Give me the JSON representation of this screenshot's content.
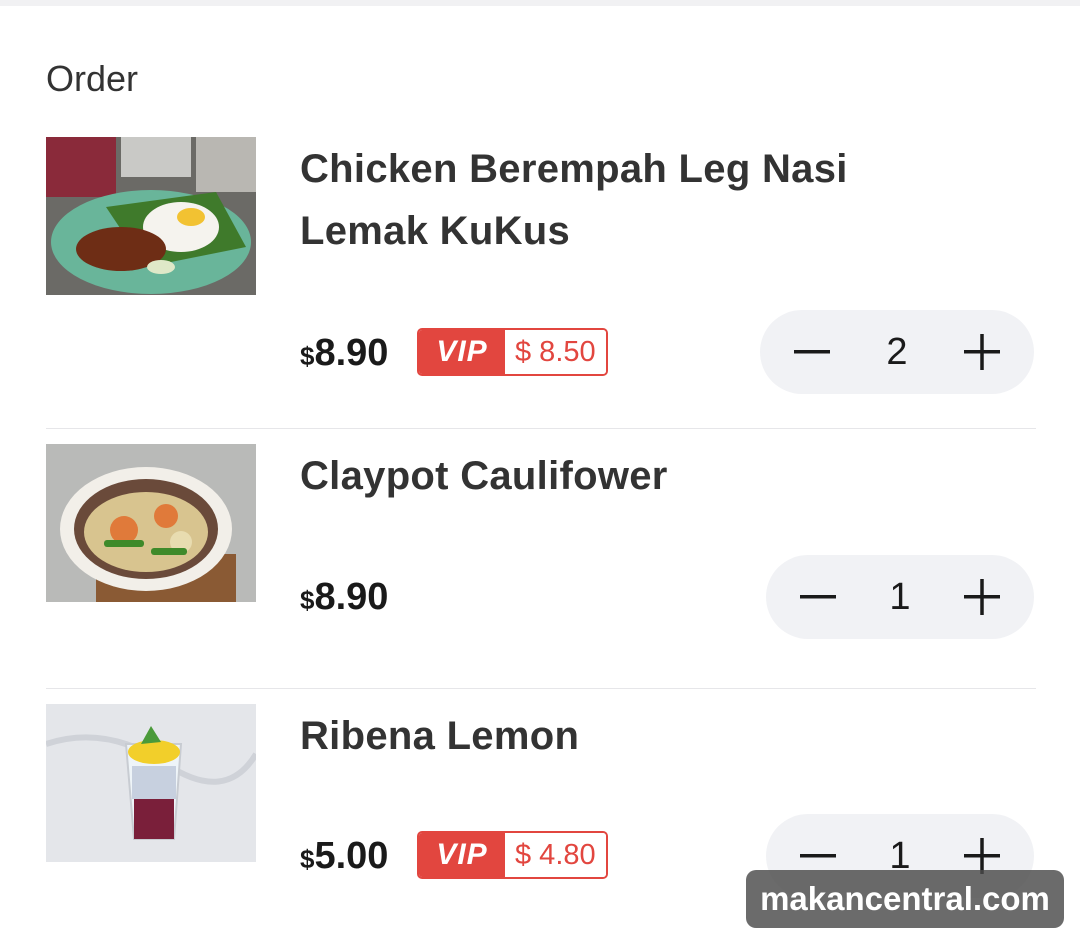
{
  "section_title": "Order",
  "items": [
    {
      "name_line1": "Chicken Berempah Leg Nasi",
      "name_line2": "Lemak KuKus",
      "currency": "$",
      "price": "8.90",
      "vip_label": "VIP",
      "vip_price": "$ 8.50",
      "quantity": "2"
    },
    {
      "name_line1": "Claypot Caulifower",
      "currency": "$",
      "price": "8.90",
      "quantity": "1"
    },
    {
      "name_line1": "Ribena Lemon",
      "currency": "$",
      "price": "5.00",
      "vip_label": "VIP",
      "vip_price": "$ 4.80",
      "quantity": "1"
    }
  ],
  "watermark": "makancentral.com",
  "icons": {
    "decrease": "minus-icon",
    "increase": "plus-icon"
  },
  "colors": {
    "vip_red": "#e2463f",
    "stepper_bg": "#f1f2f5",
    "text": "#333333"
  }
}
